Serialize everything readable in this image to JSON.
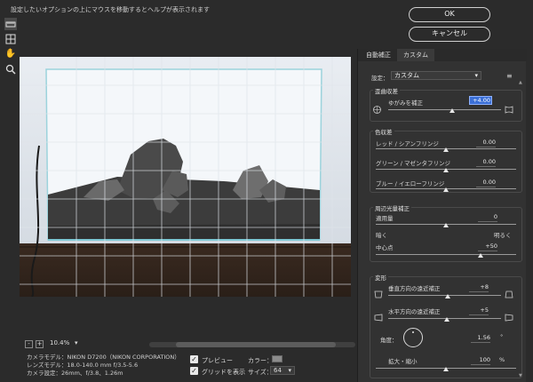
{
  "hint": "設定したいオプションの上にマウスを移動するとヘルプが表示されます",
  "tools": [
    "ruler-tool",
    "grid-tool",
    "hand-tool",
    "zoom-tool"
  ],
  "buttons": {
    "ok": "OK",
    "cancel": "キャンセル"
  },
  "zoom": {
    "value": "10.4%",
    "minus": "-",
    "plus": "+"
  },
  "camera_info": {
    "line1": "カメラモデル：NIKON D7200（NIKON CORPORATION）",
    "line2": "レンズモデル：18.0-140.0 mm f/3.5-5.6",
    "line3": "カメラ設定：26mm、f/3.8、1.26m"
  },
  "options": {
    "preview_label": "プレビュー",
    "grid_label": "グリッドを表示",
    "color_label": "カラー：",
    "size_label": "サイズ：",
    "size_value": "64",
    "grid_color": "#8c8c8c"
  },
  "panel": {
    "tabs": [
      "自動補正",
      "カスタム"
    ],
    "setting_label": "設定：",
    "setting_value": "カスタム",
    "geometric": {
      "title": "歪曲収差",
      "label": "ゆがみを補正",
      "value": "+4.00",
      "level": 0.54
    },
    "chromatic": {
      "title": "色収差",
      "rows": [
        {
          "label": "レッド / シアンフリンジ",
          "value": "0.00",
          "level": 0.5
        },
        {
          "label": "グリーン / マゼンタフリンジ",
          "value": "0.00",
          "level": 0.5
        },
        {
          "label": "ブルー / イエローフリンジ",
          "value": "0.00",
          "level": 0.5
        }
      ]
    },
    "vignette": {
      "title": "周辺光量補正",
      "amount_label": "適用量",
      "amount_value": "0",
      "darker": "暗く",
      "lighter": "明るく",
      "amount_level": 0.5,
      "midpoint_label": "中心点",
      "midpoint_value": "+50",
      "midpoint_level": 0.75
    },
    "transform": {
      "title": "変形",
      "vertical_label": "垂直方向の遠近補正",
      "vertical_value": "+8",
      "vertical_level": 0.54,
      "horizontal_label": "水平方向の遠近補正",
      "horizontal_value": "+5",
      "horizontal_level": 0.525,
      "angle_label": "角度：",
      "angle_value": "1.56",
      "angle_unit": "°",
      "scale_label": "拡大・縮小",
      "scale_value": "100",
      "scale_unit": "%",
      "scale_level": 0.5
    }
  }
}
